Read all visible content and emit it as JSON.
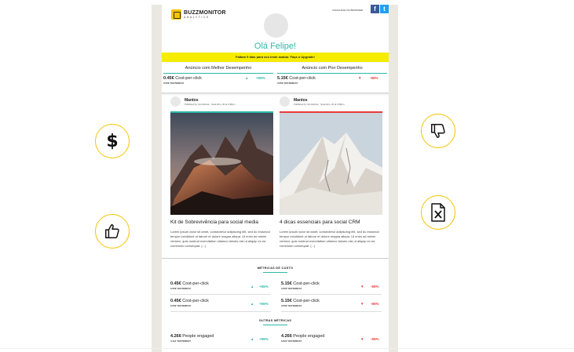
{
  "header": {
    "brand": "BUZZMONITOR",
    "brand_sub": "ANALYTICS",
    "top_link": "VISUALIZAR NO BROWSER",
    "facebook": "f",
    "twitter": "t"
  },
  "greeting": "Olá Felipe!",
  "banner": "Faltam 9 dias para seu teste acabar. Faça o Upgrade!",
  "comparison": {
    "best": {
      "title": "Anúncio com Melhor Desempenho",
      "value": "0.45€",
      "metric": "Cost-per-click",
      "sub": "0.55€ YESTERDAY",
      "trend": "+55%",
      "direction": "up"
    },
    "worst": {
      "title": "Anúncio com Pior Desempenho",
      "value": "5.15€",
      "metric": "Cost-per-click",
      "sub": "3.55€ YESTERDAY",
      "trend": "-55%",
      "direction": "down"
    }
  },
  "posts": [
    {
      "author": "Mantos",
      "meta": "Published by Yan Zerbeto · Setembro, 20 at 4:30pm",
      "title": "Kit de Sobrevivência para social media",
      "body": "Lorem ipsum dolor sit amet, consectetur adipiscing elit, sed do eiusmod tempor incididunt ut labore et dolore magna aliqua. Ut enim ad minim veniam, quis nostrud exercitation ullamco laboris nisi ut aliquip ex ea commodo consequat. (...)"
    },
    {
      "author": "Mantos",
      "meta": "Published by Yan Zerbeto · Setembro, 20 at 4:30pm",
      "title": "4 dicas essenciais para social CRM",
      "body": "Lorem ipsum dolor sit amet, consectetur adipiscing elit, sed do eiusmod tempor incididunt ut labore et dolore magna aliqua. Ut enim ad minim veniam, quis nostrud exercitation ullamco laboris nisi ut aliquip ex ea commodo consequat. (...)"
    }
  ],
  "cost_section": {
    "title": "MÉTRICAS DE CUSTO",
    "rows": [
      [
        {
          "value": "0.45€",
          "metric": "Cost-per-click",
          "sub": "0.55€ YESTERDAY",
          "trend": "+55%",
          "direction": "up"
        },
        {
          "value": "5.15€",
          "metric": "Cost-per-click",
          "sub": "3.55€ YESTERDAY",
          "trend": "-55%",
          "direction": "down"
        }
      ],
      [
        {
          "value": "0.45€",
          "metric": "Cost-per-click",
          "sub": "0.55€ YESTERDAY",
          "trend": "+55%",
          "direction": "up"
        },
        {
          "value": "5.15€",
          "metric": "Cost-per-click",
          "sub": "3.55€ YESTERDAY",
          "trend": "-55%",
          "direction": "down"
        }
      ]
    ]
  },
  "other_section": {
    "title": "OUTRAS MÉTRICAS",
    "rows": [
      [
        {
          "value": "4.266",
          "metric": "People engaged",
          "sub": "4.112 YESTERDAY",
          "trend": "+55%",
          "direction": "up"
        },
        {
          "value": "4.266",
          "metric": "People engaged",
          "sub": "6.222 YESTERDAY",
          "trend": "-55%",
          "direction": "down"
        }
      ]
    ]
  },
  "side_icons": [
    "dollar-icon",
    "thumbs-up-icon",
    "thumbs-down-icon",
    "excel-icon"
  ],
  "colors": {
    "accent": "#2eb8a8",
    "banner": "#f5ec00",
    "positive": "#2eb8a8",
    "negative": "#e83a3a",
    "icon_ring": "#f5c400"
  }
}
